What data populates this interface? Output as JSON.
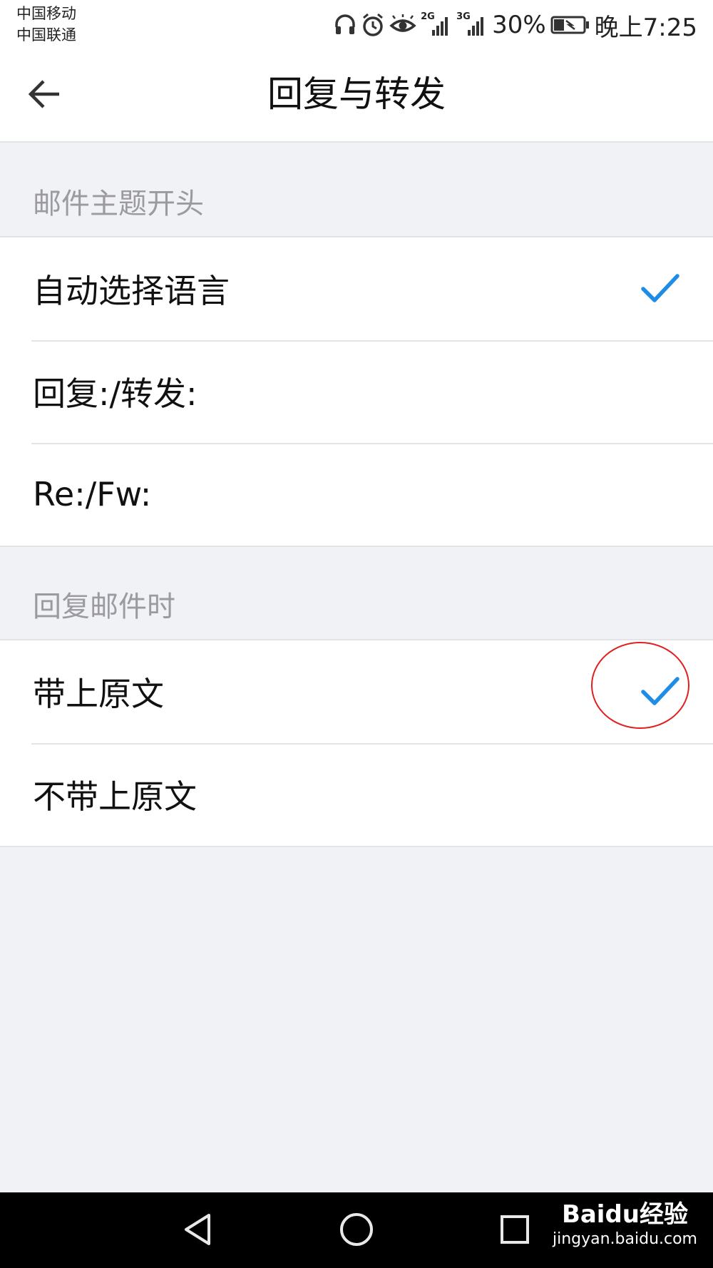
{
  "status_bar": {
    "carrier_1": "中国移动",
    "carrier_2": "中国联通",
    "network_1": "2G",
    "network_2": "3G",
    "battery": "30%",
    "time": "晚上7:25",
    "icons": [
      "headset-icon",
      "alarm-icon",
      "eye-icon",
      "signal-icon",
      "signal-icon",
      "battery-icon"
    ]
  },
  "header": {
    "title": "回复与转发",
    "back_icon": "back-arrow-icon"
  },
  "sections": [
    {
      "header": "邮件主题开头",
      "options": [
        {
          "label": "自动选择语言",
          "selected": true
        },
        {
          "label": "回复:/转发:",
          "selected": false
        },
        {
          "label": "Re:/Fw:",
          "selected": false
        }
      ]
    },
    {
      "header": "回复邮件时",
      "options": [
        {
          "label": "带上原文",
          "selected": true
        },
        {
          "label": "不带上原文",
          "selected": false
        }
      ]
    }
  ],
  "annotation": {
    "shape": "circle",
    "color": "#e02020",
    "target": "带上原文 checkmark"
  },
  "nav_bar": {
    "buttons": [
      "back-nav-icon",
      "home-nav-icon",
      "recents-nav-icon"
    ]
  },
  "watermark": {
    "main": "Baidu经验",
    "sub": "jingyan.baidu.com"
  },
  "colors": {
    "accent_check": "#1f8ce6",
    "background": "#f1f2f6",
    "divider": "#e3e4e8"
  }
}
